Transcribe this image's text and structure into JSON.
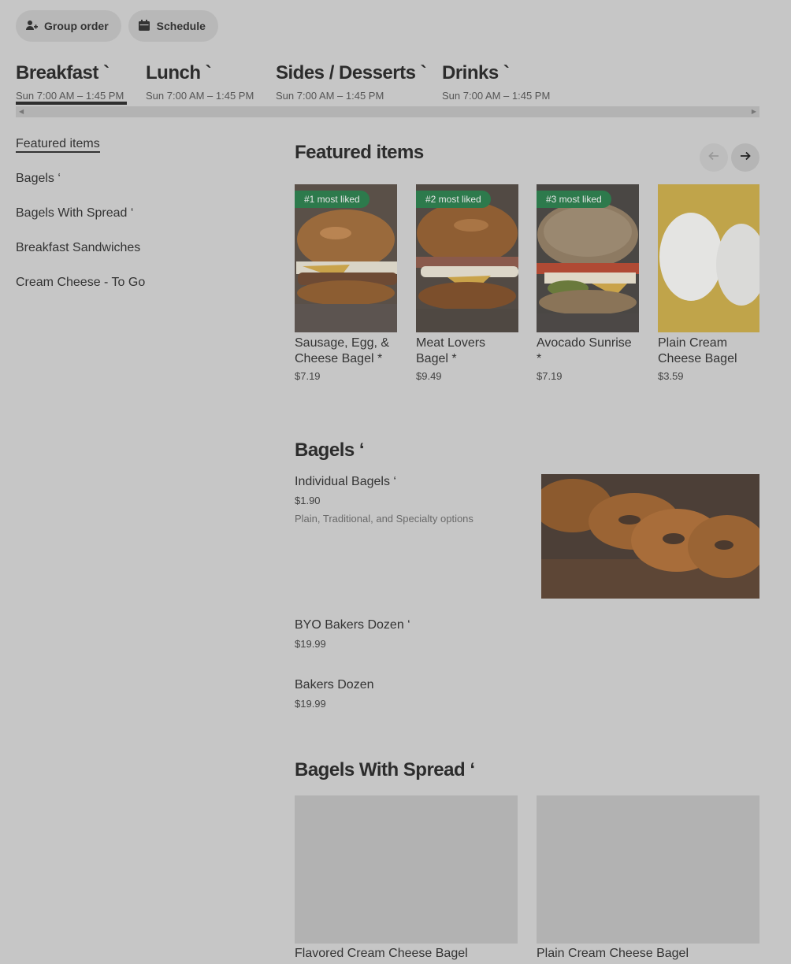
{
  "actions": {
    "group_order": "Group order",
    "schedule": "Schedule"
  },
  "menus": [
    {
      "name": "Breakfast `",
      "hours": "Sun 7:00 AM – 1:45 PM",
      "active": true
    },
    {
      "name": "Lunch `",
      "hours": "Sun 7:00 AM – 1:45 PM",
      "active": false
    },
    {
      "name": "Sides / Desserts `",
      "hours": "Sun 7:00 AM – 1:45 PM",
      "active": false
    },
    {
      "name": "Drinks `",
      "hours": "Sun 7:00 AM – 1:45 PM",
      "active": false
    }
  ],
  "sidebar": {
    "items": [
      {
        "label": "Featured items"
      },
      {
        "label": "Bagels ‘"
      },
      {
        "label": "Bagels With Spread ‘"
      },
      {
        "label": "Breakfast Sandwiches"
      },
      {
        "label": "Cream Cheese - To Go"
      }
    ]
  },
  "featured": {
    "title": "Featured items",
    "items": [
      {
        "badge": "#1 most liked",
        "name": "Sausage, Egg, & Cheese Bagel *",
        "price": "$7.19"
      },
      {
        "badge": "#2 most liked",
        "name": "Meat Lovers Bagel *",
        "price": "$9.49"
      },
      {
        "badge": "#3 most liked",
        "name": "Avocado Sunrise *",
        "price": "$7.19"
      },
      {
        "badge": "",
        "name": "Plain Cream Cheese Bagel",
        "price": "$3.59"
      }
    ]
  },
  "bagels": {
    "title": "Bagels ‘",
    "items": [
      {
        "name": "Individual Bagels ‘",
        "price": "$1.90",
        "desc": "Plain, Traditional, and Specialty options"
      },
      {
        "name": "BYO Bakers Dozen ‘",
        "price": "$19.99"
      },
      {
        "name": "Bakers Dozen",
        "price": "$19.99"
      }
    ]
  },
  "bagels_spread": {
    "title": "Bagels With Spread ‘",
    "items": [
      {
        "name": "Flavored Cream Cheese Bagel"
      },
      {
        "name": "Plain Cream Cheese Bagel"
      }
    ]
  },
  "colors": {
    "badge": "#2d7a4c",
    "overlay_bg": "#c6c6c6"
  },
  "icons": {
    "group_order": "person-add-icon",
    "schedule": "calendar-icon",
    "prev": "arrow-left-icon",
    "next": "arrow-right-icon"
  }
}
